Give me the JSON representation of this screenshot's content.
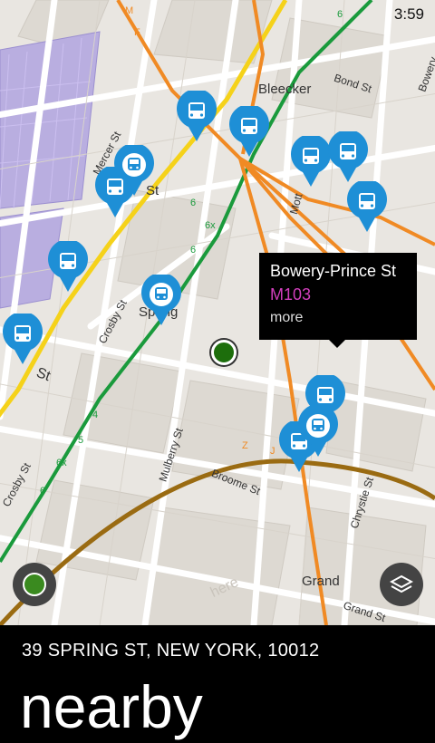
{
  "status": {
    "time": "3:59"
  },
  "map": {
    "labels": {
      "bleecker": "Bleecker",
      "bond_st": "Bond St",
      "bowery": "Bowery",
      "mercer_st": "Mercer St",
      "st_fragment": "St",
      "crosby_st_1": "Crosby St",
      "crosby_st_2": "Crosby St",
      "spring_st_fragment": "Spring",
      "prince_st": "St",
      "mulberry_st": "Mulberry St",
      "broome_st": "Broome St",
      "chrystie_st": "Chrystie St",
      "grand": "Grand",
      "grand_st": "Grand St",
      "mott": "Mott",
      "here_watermark": "here",
      "line_6_a": "6",
      "line_6_b": "6",
      "line_6x": "6x",
      "line_5": "5",
      "line_4": "4",
      "line_6_c": "6",
      "line_6x_b": "6x",
      "line_6_d": "6",
      "line_f": "F",
      "line_m": "M",
      "line_j": "J",
      "line_z": "Z"
    },
    "tooltip": {
      "title": "Bowery-Prince St",
      "route": "M103",
      "more": "more"
    },
    "pins": [
      {
        "type": "bus-icon"
      },
      {
        "type": "bus-icon"
      },
      {
        "type": "bus-icon"
      },
      {
        "type": "bus-icon"
      },
      {
        "type": "bus-icon"
      },
      {
        "type": "bus-icon"
      },
      {
        "type": "bus-icon"
      },
      {
        "type": "bus-icon"
      },
      {
        "type": "bus-icon"
      },
      {
        "type": "bus-icon"
      },
      {
        "type": "subway-icon"
      },
      {
        "type": "subway-icon"
      },
      {
        "type": "subway-icon"
      }
    ],
    "colors": {
      "pin_blue": "#1e8fd6",
      "subway_green": "#1a9a3c",
      "line_orange": "#f08a24",
      "line_yellow": "#f5d21a",
      "line_brown": "#9a6b12",
      "route_magenta": "#d23fbd"
    }
  },
  "bottom_panel": {
    "address": "39 SPRING ST, NEW YORK, 10012",
    "title": "nearby"
  }
}
